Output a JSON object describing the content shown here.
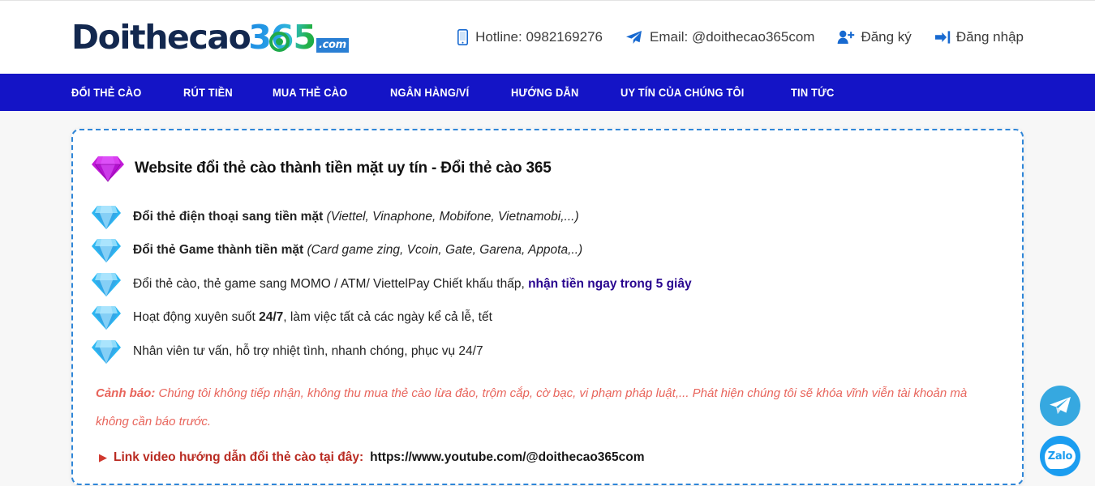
{
  "header": {
    "logo": {
      "main": "Doithecao",
      "accent": "365",
      "suffix": ".com"
    },
    "hotline": {
      "icon": "mobile-phone-icon",
      "text": "Hotline: 0982169276"
    },
    "email": {
      "icon": "paper-plane-icon",
      "text": "Email: @doithecao365com"
    },
    "register": {
      "icon": "user-plus-icon",
      "label": "Đăng ký"
    },
    "login": {
      "icon": "sign-in-icon",
      "label": "Đăng nhập"
    }
  },
  "nav": {
    "items": [
      {
        "label": "ĐỔI THẺ CÀO"
      },
      {
        "label": "RÚT TIỀN"
      },
      {
        "label": "MUA THẺ CÀO"
      },
      {
        "label": "NGÂN HÀNG/VÍ"
      },
      {
        "label": "HƯỚNG DẪN"
      },
      {
        "label": "UY TÍN CỦA CHÚNG TÔI"
      },
      {
        "label": "TIN TỨC"
      }
    ]
  },
  "content": {
    "title": "Website đổi thẻ cào thành tiền mặt uy tín - Đổi thẻ cào 365",
    "title_icon": "purple-gem-icon",
    "bullet_icon": "blue-gem-icon",
    "features": [
      {
        "bold": "Đổi thẻ điện thoại sang tiền mặt",
        "italic": " (Viettel, Vinaphone, Mobifone, Vietnamobi,...)"
      },
      {
        "bold": "Đổi thẻ Game thành tiền mặt",
        "italic": " (Card game zing, Vcoin, Gate, Garena, Appota,..)"
      },
      {
        "plain": "Đổi thẻ cào, thẻ game sang MOMO / ATM/ ViettelPay Chiết khấu thấp, ",
        "highlight": "nhận tiền ngay trong 5 giây"
      },
      {
        "plain_pre": "Hoạt động xuyên suốt ",
        "bold_mid": "24/7",
        "plain_post": ", làm việc tất cả các ngày kể cả lễ, tết"
      },
      {
        "plain": "Nhân viên tư vấn, hỗ trợ nhiệt tình, nhanh chóng, phục vụ 24/7"
      }
    ],
    "warning": {
      "label": "Cảnh báo:",
      "text": " Chúng tôi không tiếp nhận, không thu mua thẻ cào lừa đảo, trộm cắp, cờ bạc, vi phạm pháp luật,... Phát hiện chúng tôi sẽ khóa vĩnh viễn tài khoản mà không cần báo trước."
    },
    "link_line": {
      "marker": "▶",
      "label": "Link video hướng dẫn đổi thẻ cào tại đây:",
      "url": "https://www.youtube.com/@doithecao365com"
    }
  },
  "floating": {
    "telegram": {
      "icon": "telegram-icon",
      "label": ""
    },
    "zalo": {
      "icon": "zalo-icon",
      "label": "Zalo"
    }
  },
  "colors": {
    "nav_blue": "#1414c6",
    "accent_blue": "#1769d0",
    "warning_red": "#e8655c",
    "link_red": "#b92b22",
    "highlight_indigo": "#29068f",
    "page_bg": "#f7f7f7"
  }
}
